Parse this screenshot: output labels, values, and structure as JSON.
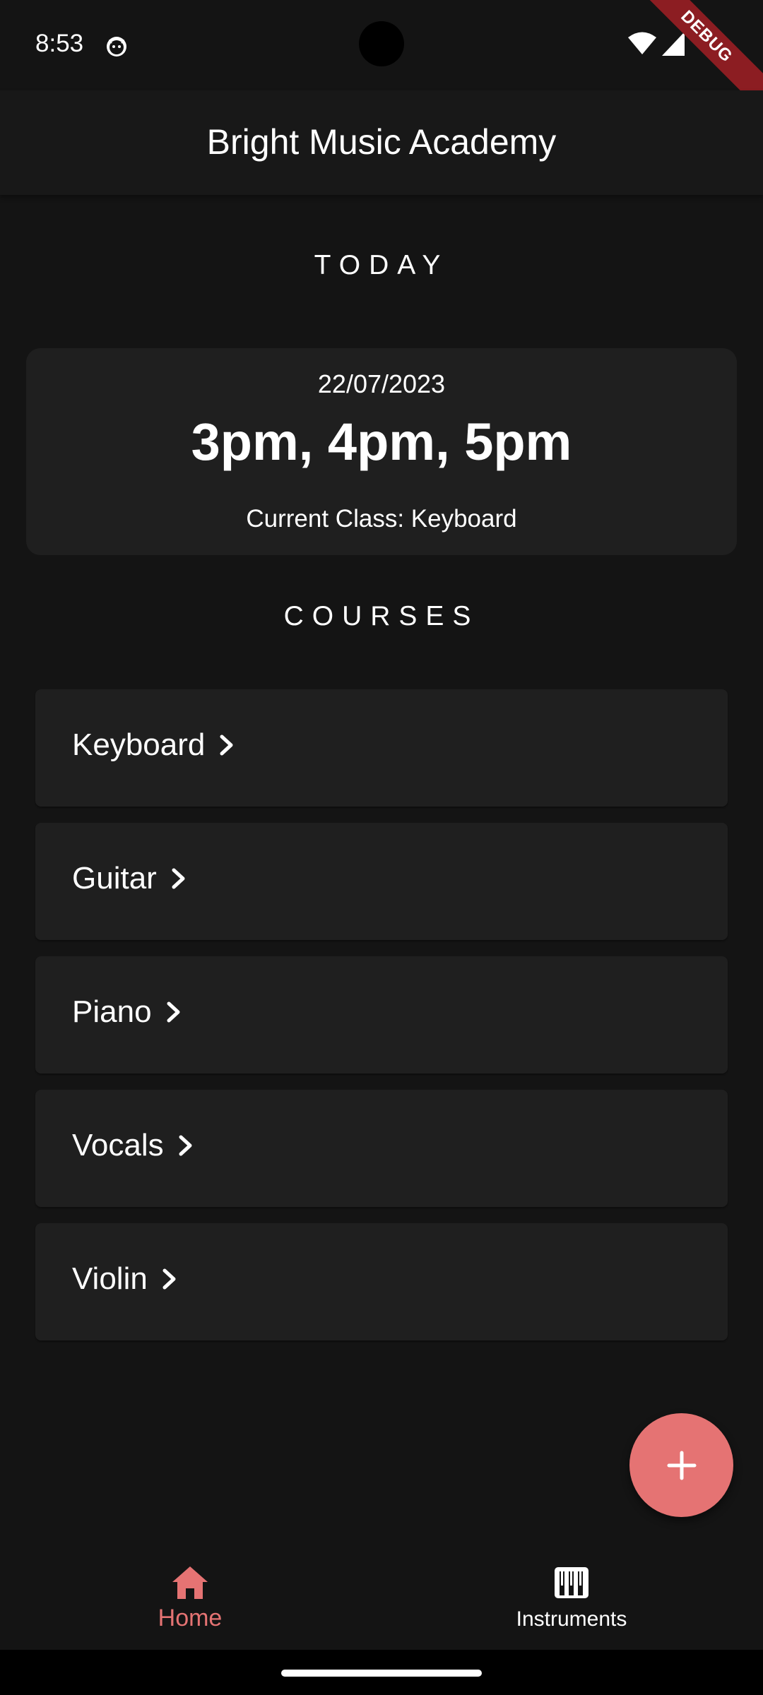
{
  "status_bar": {
    "time": "8:53",
    "app_icon": "cat-icon",
    "wifi_icon": "wifi-icon",
    "signal_icon": "cell-signal-icon",
    "debug_label": "DEBUG"
  },
  "app_bar": {
    "title": "Bright Music Academy"
  },
  "today": {
    "header": "TODAY",
    "date": "22/07/2023",
    "times": "3pm, 4pm, 5pm",
    "current_class": "Current Class: Keyboard"
  },
  "courses": {
    "header": "COURSES",
    "items": [
      {
        "label": "Keyboard",
        "icon": "chevron-right-icon"
      },
      {
        "label": "Guitar",
        "icon": "chevron-right-icon"
      },
      {
        "label": "Piano",
        "icon": "chevron-right-icon"
      },
      {
        "label": "Vocals",
        "icon": "chevron-right-icon"
      },
      {
        "label": "Violin",
        "icon": "chevron-right-icon"
      }
    ]
  },
  "fab": {
    "icon": "plus-icon"
  },
  "bottom_nav": {
    "items": [
      {
        "label": "Home",
        "icon": "home-icon",
        "active": true
      },
      {
        "label": "Instruments",
        "icon": "piano-keys-icon",
        "active": false
      }
    ]
  },
  "colors": {
    "background": "#141414",
    "surface": "#1f1f1f",
    "accent": "#e57373",
    "debug_ribbon": "#8c1d22"
  }
}
